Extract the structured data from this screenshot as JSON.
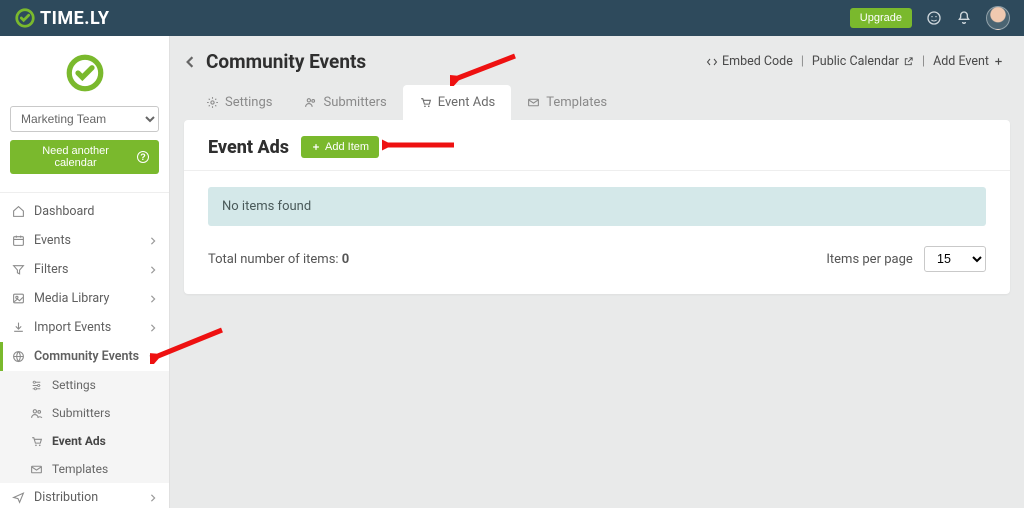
{
  "topbar": {
    "brand": "TIME.LY",
    "upgrade": "Upgrade"
  },
  "sidebar": {
    "team_selected": "Marketing Team",
    "need_calendar": "Need another calendar",
    "items": [
      {
        "label": "Dashboard"
      },
      {
        "label": "Events"
      },
      {
        "label": "Filters"
      },
      {
        "label": "Media Library"
      },
      {
        "label": "Import Events"
      },
      {
        "label": "Community Events"
      },
      {
        "label": "Distribution"
      }
    ],
    "community_sub": [
      {
        "label": "Settings"
      },
      {
        "label": "Submitters"
      },
      {
        "label": "Event Ads"
      },
      {
        "label": "Templates"
      }
    ]
  },
  "page": {
    "title": "Community Events",
    "embed_code": "Embed Code",
    "public_calendar": "Public Calendar",
    "add_event": "Add Event",
    "tabs": {
      "settings": "Settings",
      "submitters": "Submitters",
      "event_ads": "Event Ads",
      "templates": "Templates"
    },
    "panel_title": "Event Ads",
    "add_item": "Add Item",
    "no_items": "No items found",
    "total_label": "Total number of items:",
    "total_value": "0",
    "items_per_page_label": "Items per page",
    "items_per_page_value": "15"
  }
}
